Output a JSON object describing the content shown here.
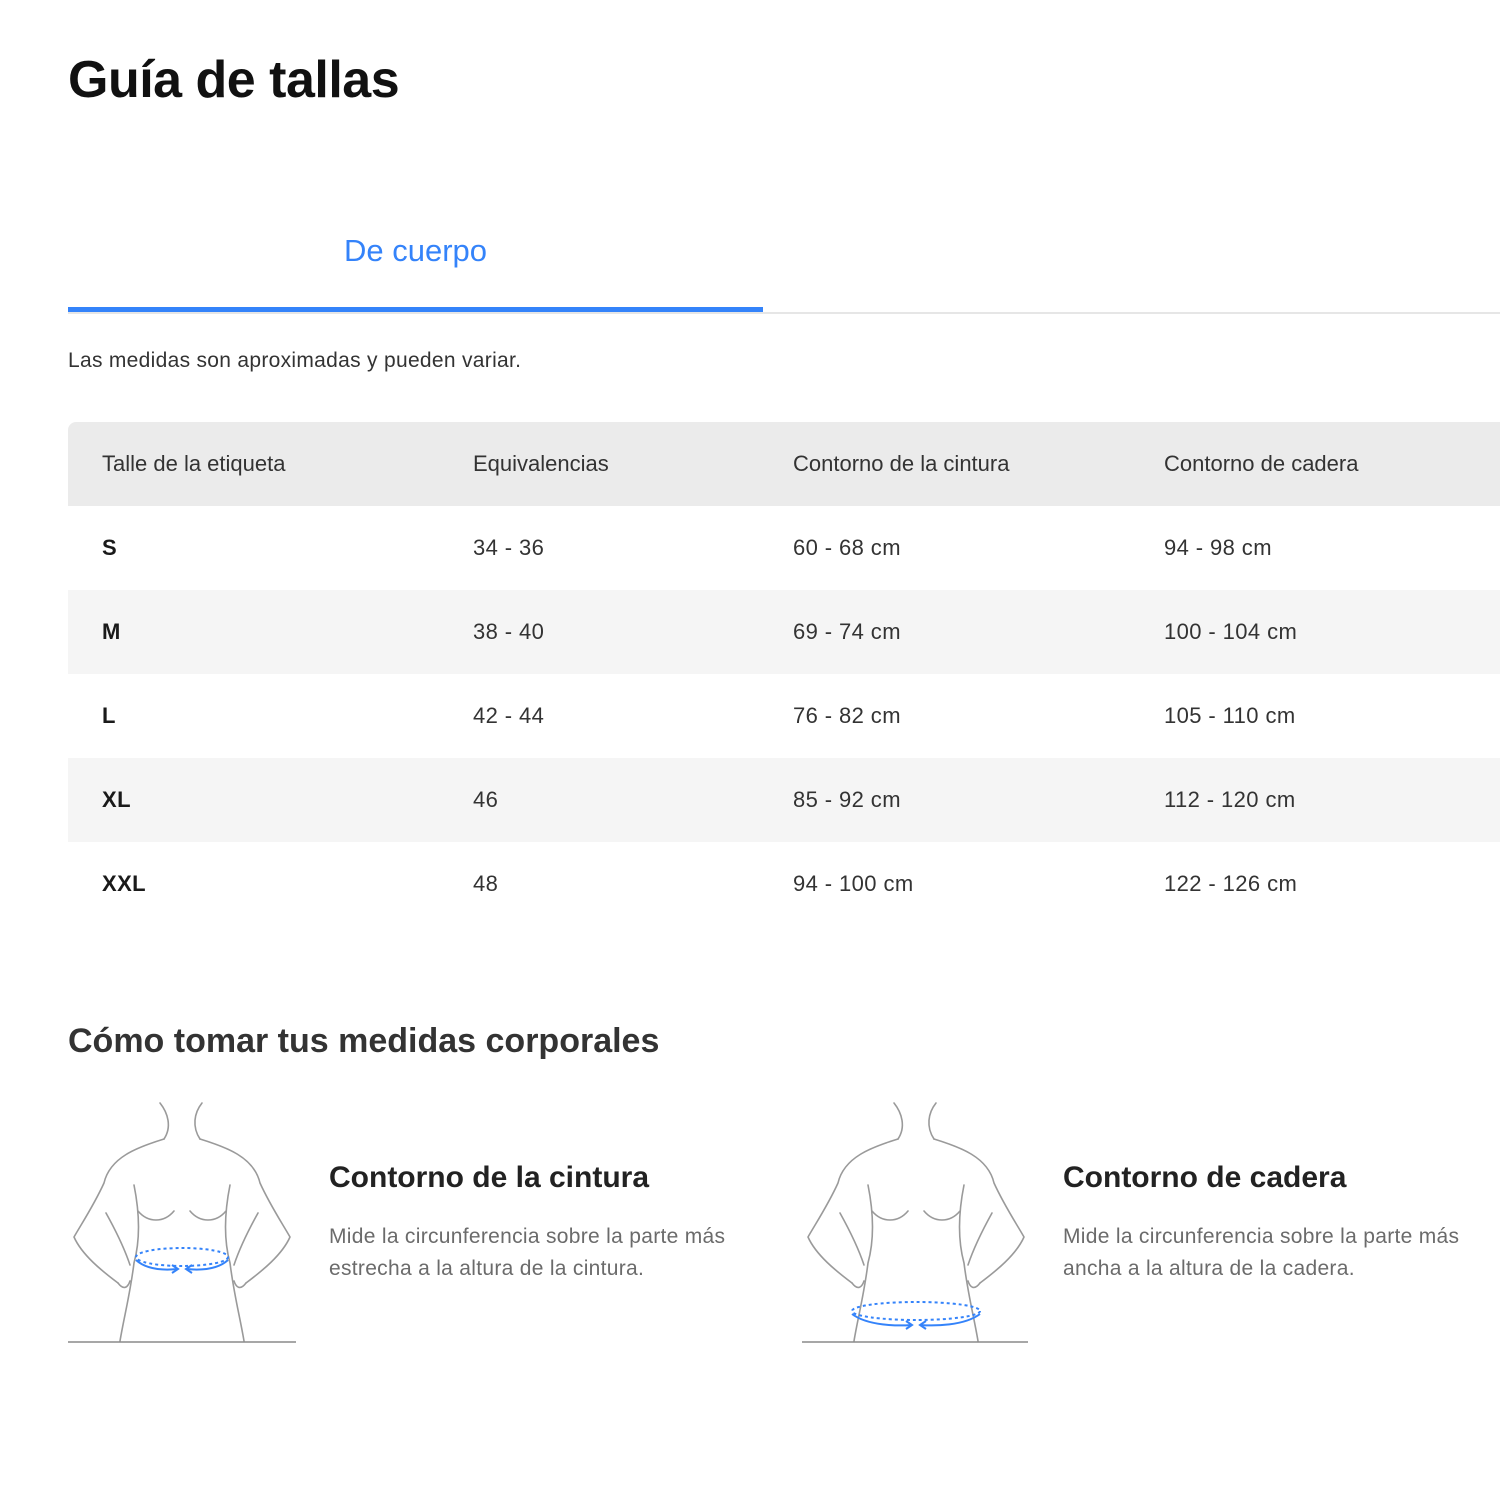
{
  "title": "Guía de tallas",
  "tabs": [
    {
      "label": "De cuerpo",
      "active": true
    }
  ],
  "note": "Las medidas son aproximadas y pueden variar.",
  "table": {
    "headers": [
      "Talle de la etiqueta",
      "Equivalencias",
      "Contorno de la cintura",
      "Contorno de cadera"
    ],
    "rows": [
      [
        "S",
        "34 - 36",
        "60 - 68 cm",
        "94 - 98 cm"
      ],
      [
        "M",
        "38 - 40",
        "69 - 74 cm",
        "100 - 104 cm"
      ],
      [
        "L",
        "42 - 44",
        "76 - 82 cm",
        "105 - 110 cm"
      ],
      [
        "XL",
        "46",
        "85 - 92 cm",
        "112 - 120 cm"
      ],
      [
        "XXL",
        "48",
        "94 - 100 cm",
        "122 - 126 cm"
      ]
    ]
  },
  "guide": {
    "title": "Cómo tomar tus medidas corporales",
    "items": [
      {
        "title": "Contorno de la cintura",
        "text": "Mide la circunferencia sobre la parte más estrecha a la altura de la cintura.",
        "icon": "waist-measure-icon"
      },
      {
        "title": "Contorno de cadera",
        "text": "Mide la circunferencia sobre la parte más ancha a la altura de la cadera.",
        "icon": "hip-measure-icon"
      }
    ]
  },
  "colors": {
    "accent": "#3483fa",
    "header_bg": "#ebebeb",
    "stripe_bg": "#f5f5f5",
    "text": "#333333",
    "muted": "#6b6b6b"
  }
}
